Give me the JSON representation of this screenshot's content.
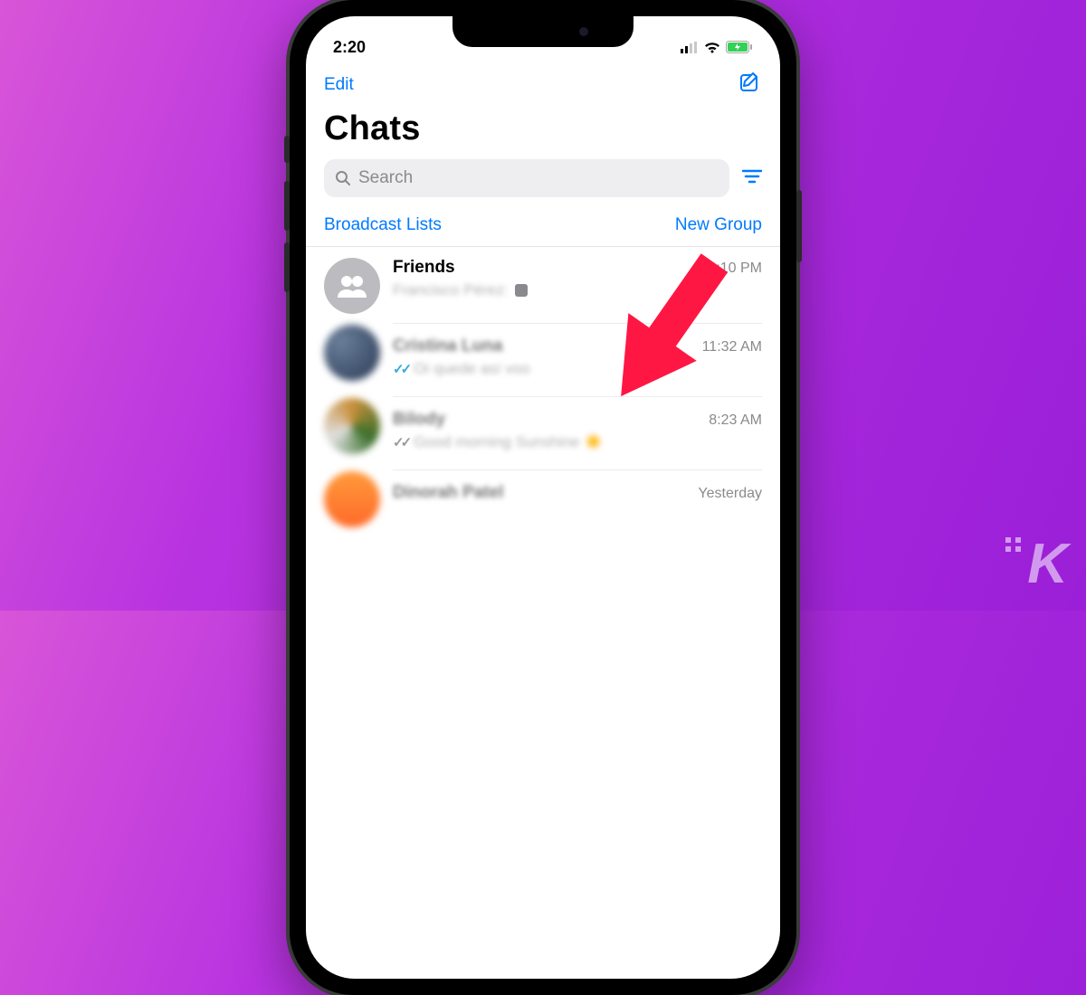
{
  "status": {
    "time": "2:20"
  },
  "nav": {
    "edit": "Edit"
  },
  "title": "Chats",
  "search": {
    "placeholder": "Search"
  },
  "links": {
    "broadcast": "Broadcast Lists",
    "newgroup": "New Group"
  },
  "chats": [
    {
      "name": "Friends",
      "time": "12:10 PM",
      "preview": "Francisco Pérez:",
      "avatar": "group",
      "check": ""
    },
    {
      "name": "Cristina Luna",
      "time": "11:32 AM",
      "preview": "Oi quede así voo",
      "avatar": "blur1",
      "check": "blue"
    },
    {
      "name": "Bilody",
      "time": "8:23 AM",
      "preview": "Good morning Sunshine ☀️",
      "avatar": "blur2",
      "check": "gray"
    },
    {
      "name": "Dinorah Patel",
      "time": "Yesterday",
      "preview": "",
      "avatar": "blur3",
      "check": ""
    }
  ]
}
